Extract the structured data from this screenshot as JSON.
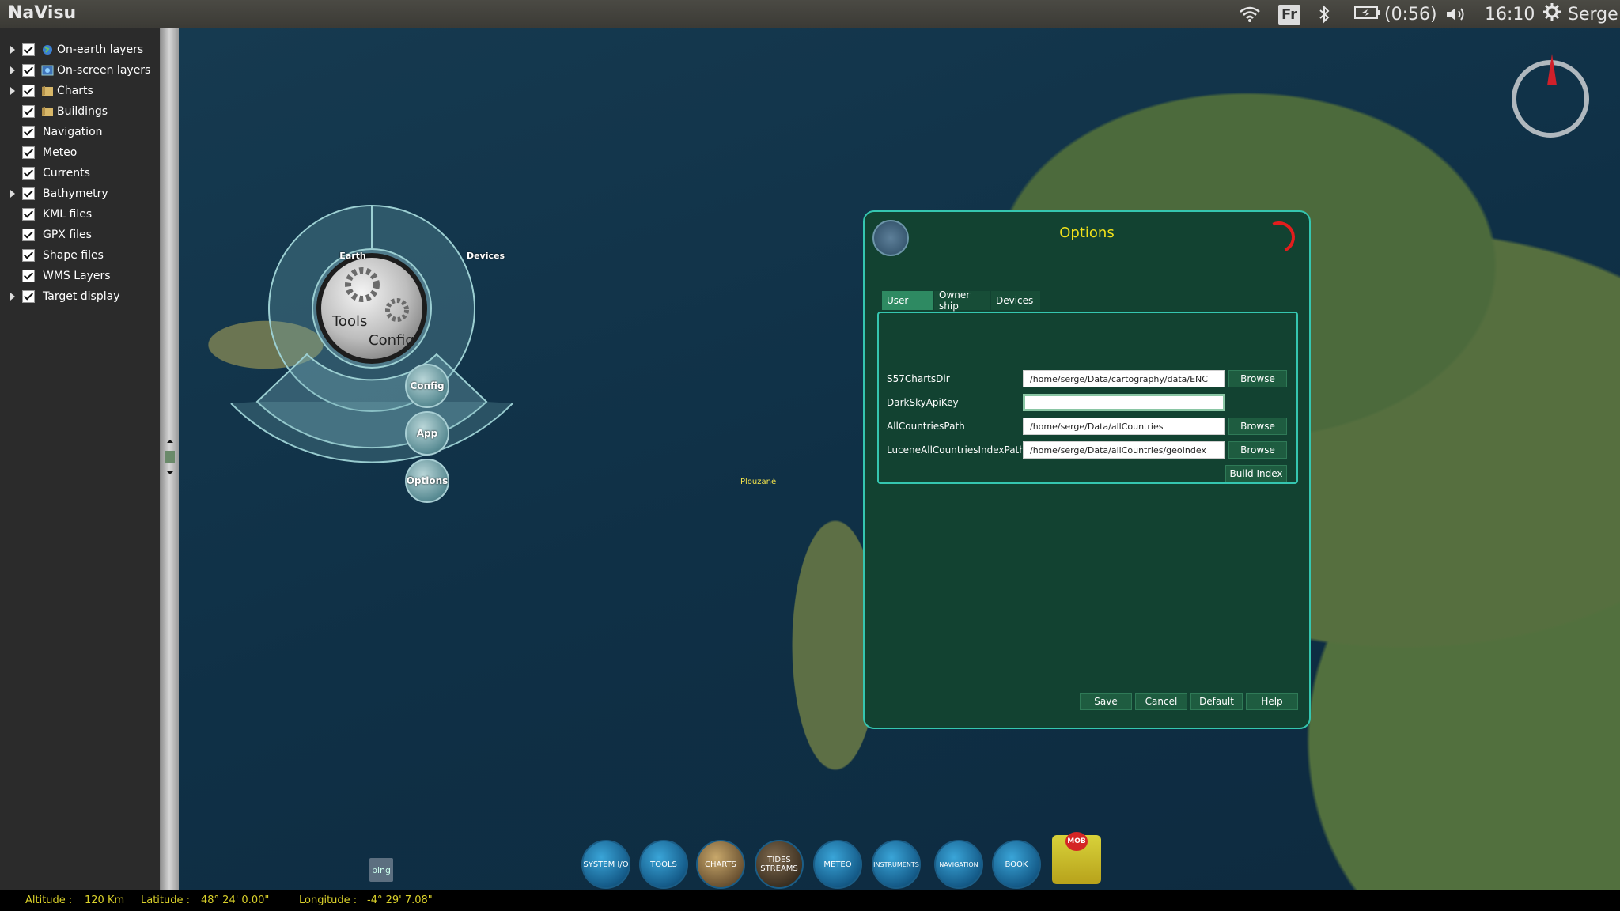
{
  "app": {
    "title": "NaVisu"
  },
  "tray": {
    "keyboard": "Fr",
    "battery": "(0:56)",
    "clock": "16:10",
    "user": "Serge"
  },
  "layers": [
    {
      "label": "On-earth layers",
      "expandable": true,
      "icon": "globe-icon"
    },
    {
      "label": "On-screen layers",
      "expandable": true,
      "icon": "screen-layers-icon"
    },
    {
      "label": "Charts",
      "expandable": true,
      "icon": "chart-icon"
    },
    {
      "label": "Buildings",
      "expandable": false,
      "icon": "buildings-icon"
    },
    {
      "label": "Navigation",
      "expandable": false
    },
    {
      "label": "Meteo",
      "expandable": false
    },
    {
      "label": "Currents",
      "expandable": false
    },
    {
      "label": "Bathymetry",
      "expandable": true
    },
    {
      "label": "KML files",
      "expandable": false
    },
    {
      "label": "GPX files",
      "expandable": false
    },
    {
      "label": "Shape files",
      "expandable": false
    },
    {
      "label": "WMS Layers",
      "expandable": false
    },
    {
      "label": "Target display",
      "expandable": true
    }
  ],
  "radial_menu": {
    "center_top": "Tools",
    "center_bottom": "Config",
    "left": "Earth",
    "right": "Devices",
    "items": [
      "Config",
      "App",
      "Options"
    ]
  },
  "map": {
    "place_label": "Plouzané",
    "attribution": "bing"
  },
  "dialog": {
    "title": "Options",
    "tabs": [
      "User",
      "Owner ship",
      "Devices"
    ],
    "active_tab": "User",
    "fields": [
      {
        "label": "S57ChartsDir",
        "value": "/home/serge/Data/cartography/data/ENC",
        "button": "Browse"
      },
      {
        "label": "DarkSkyApiKey",
        "value": "",
        "button": ""
      },
      {
        "label": "AllCountriesPath",
        "value": "/home/serge/Data/allCountries",
        "button": "Browse"
      },
      {
        "label": "LuceneAllCountriesIndexPath",
        "value": "/home/serge/Data/allCountries/geoIndex",
        "button": "Browse"
      }
    ],
    "build_index": "Build Index",
    "buttons": {
      "save": "Save",
      "cancel": "Cancel",
      "default": "Default",
      "help": "Help"
    }
  },
  "dock": [
    {
      "label": "SYSTEM I/O"
    },
    {
      "label": "TOOLS"
    },
    {
      "label": "CHARTS"
    },
    {
      "label": "TIDES STREAMS"
    },
    {
      "label": "METEO"
    },
    {
      "label": "INSTRUMENTS"
    },
    {
      "label": "NAVIGATION"
    },
    {
      "label": "BOOK"
    }
  ],
  "mob": {
    "label": "MOB"
  },
  "status": {
    "altitude_label": "Altitude :",
    "altitude": "120 Km",
    "latitude_label": "Latitude :",
    "latitude": "48° 24' 0.00\"",
    "longitude_label": "Longitude :",
    "longitude": "-4° 29' 7.08\""
  },
  "colors": {
    "accent": "#35c6b0",
    "dialog_bg": "#124231",
    "title": "#f2e21a",
    "status_text": "#d9d02a"
  }
}
